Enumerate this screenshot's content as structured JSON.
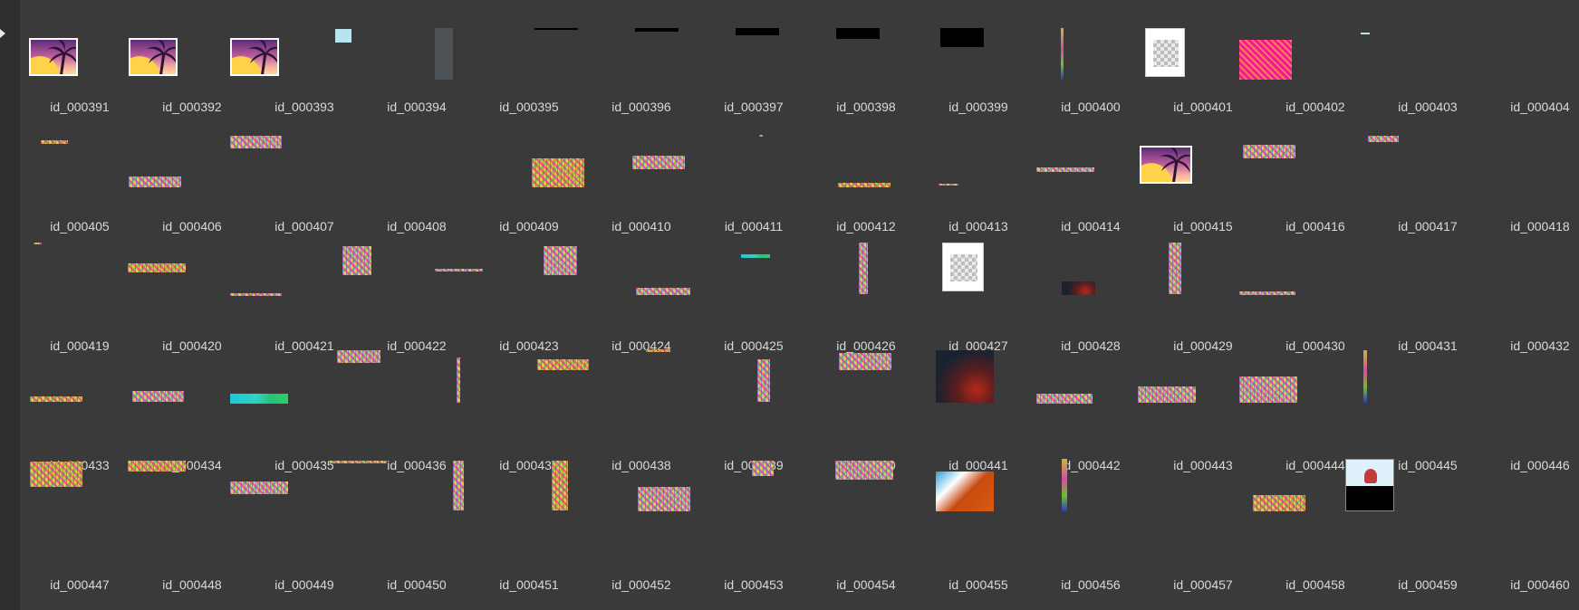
{
  "cells": [
    "id_000391",
    "id_000392",
    "id_000393",
    "id_000394",
    "id_000395",
    "id_000396",
    "id_000397",
    "id_000398",
    "id_000399",
    "id_000400",
    "id_000401",
    "id_000402",
    "id_000403",
    "id_000404",
    "id_000405",
    "id_000406",
    "id_000407",
    "id_000408",
    "id_000409",
    "id_000410",
    "id_000411",
    "id_000412",
    "id_000413",
    "id_000414",
    "id_000415",
    "id_000416",
    "id_000417",
    "id_000418",
    "id_000419",
    "id_000420",
    "id_000421",
    "id_000422",
    "id_000423",
    "id_000424",
    "id_000425",
    "id_000426",
    "id_000427",
    "id_000428",
    "id_000429",
    "id_000430",
    "id_000431",
    "id_000432",
    "id_000433",
    "id_000434",
    "id_000435",
    "id_000436",
    "id_000437",
    "id_000438",
    "id_000439",
    "id_000440",
    "id_000441",
    "id_000442",
    "id_000443",
    "id_000444",
    "id_000445",
    "id_000446",
    "id_000447",
    "id_000448",
    "id_000449",
    "id_000450",
    "id_000451",
    "id_000452",
    "id_000453",
    "id_000454",
    "id_000455",
    "id_000456",
    "id_000457",
    "id_000458",
    "id_000459",
    "id_000460"
  ],
  "colors": {
    "background": "#3a3a3a",
    "label_text": "#d9d9d9",
    "left_strip": "#2f2f2f"
  },
  "icons": {
    "corner": "collapse-arrow-icon",
    "placeholder": "palm-sunset-image-icon",
    "transparent": "transparency-checker-icon"
  }
}
